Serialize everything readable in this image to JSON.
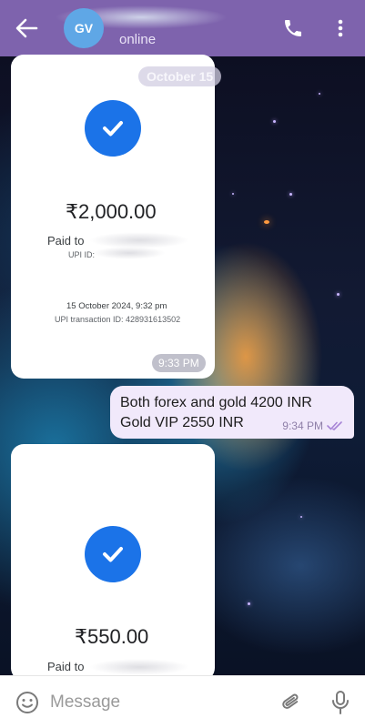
{
  "header": {
    "avatar_initials": "GV",
    "status": "online",
    "accent_color": "#7e63ad"
  },
  "chat": {
    "date_chip": "October 15",
    "messages": [
      {
        "type": "receipt",
        "amount": "₹2,000.00",
        "paid_to": "Paid to",
        "upi_id_label": "UPI ID:",
        "date_time": "15 October 2024, 9:32 pm",
        "transaction_id": "UPI transaction ID: 428931613502",
        "sent_time": "9:33 PM"
      },
      {
        "type": "text",
        "text": "Both forex and gold 4200 INR\nGold VIP 2550 INR",
        "sent_time": "9:34 PM",
        "status_icon": "double-check-icon"
      },
      {
        "type": "receipt",
        "amount": "₹550.00",
        "paid_to": "Paid to"
      }
    ]
  },
  "composer": {
    "placeholder": "Message"
  }
}
